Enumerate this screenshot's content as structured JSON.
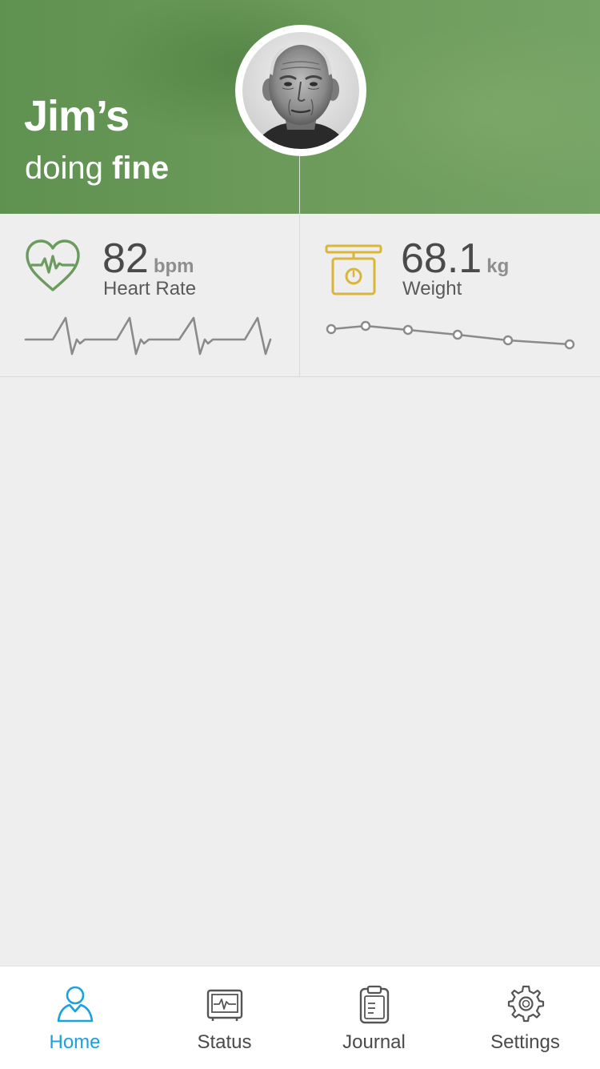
{
  "header": {
    "name": "Jim’s",
    "status_prefix": "doing",
    "status_word": "fine"
  },
  "avatar": {
    "icon": "elderly-man-portrait"
  },
  "metrics": {
    "heart_rate": {
      "value": "82",
      "unit": "bpm",
      "label": "Heart Rate",
      "icon": "heart-pulse-icon",
      "color": "#6b9b5e"
    },
    "weight": {
      "value": "68.1",
      "unit": "kg",
      "label": "Weight",
      "icon": "scale-icon",
      "color": "#d9b53a",
      "trend_points": 6
    }
  },
  "tabbar": {
    "active_color": "#1ba1dc",
    "tabs": [
      {
        "label": "Home",
        "icon": "person-icon",
        "active": true
      },
      {
        "label": "Status",
        "icon": "monitor-icon",
        "active": false
      },
      {
        "label": "Journal",
        "icon": "clipboard-icon",
        "active": false
      },
      {
        "label": "Settings",
        "icon": "gear-icon",
        "active": false
      }
    ]
  }
}
